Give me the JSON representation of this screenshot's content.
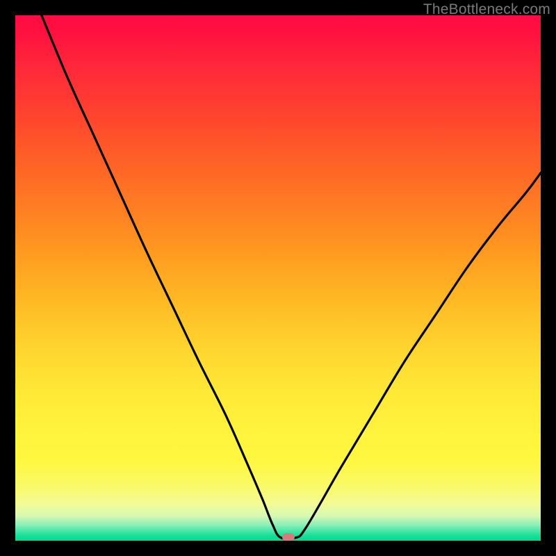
{
  "watermark": "TheBottleneck.com",
  "marker": {
    "x_pct": 52.0,
    "y_pct": 99.4
  },
  "chart_data": {
    "type": "line",
    "title": "",
    "xlabel": "",
    "ylabel": "",
    "xlim": [
      0,
      100
    ],
    "ylim": [
      0,
      100
    ],
    "series": [
      {
        "name": "bottleneck-curve",
        "x": [
          5.0,
          10,
          15,
          20,
          25,
          30,
          35,
          40,
          44,
          47,
          49,
          50.5,
          53.5,
          55,
          58,
          62,
          68,
          74,
          80,
          86,
          92,
          97,
          100
        ],
        "y": [
          100,
          88,
          77,
          66,
          55,
          44.5,
          34,
          24,
          15,
          8,
          3,
          0.6,
          0.6,
          2,
          7,
          14,
          24,
          34,
          43,
          52,
          60,
          66,
          70
        ]
      }
    ],
    "annotations": [
      {
        "type": "marker",
        "x": 52.0,
        "y": 0.6,
        "label": "optimal-point"
      }
    ],
    "background_gradient": {
      "direction": "vertical",
      "stops": [
        {
          "pct": 0,
          "color": "#ff0b44"
        },
        {
          "pct": 50,
          "color": "#ffae22"
        },
        {
          "pct": 85,
          "color": "#fff741"
        },
        {
          "pct": 100,
          "color": "#00dc91"
        }
      ]
    }
  }
}
